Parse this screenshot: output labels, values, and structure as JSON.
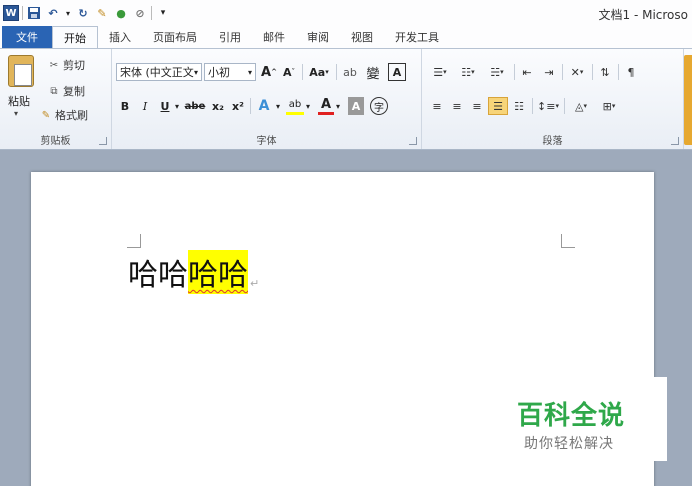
{
  "window": {
    "title": "文档1 - Microso"
  },
  "qat": {
    "word_icon": "W",
    "save_icon": "save-icon",
    "undo_icon": "undo-icon",
    "redo_icon": "redo-icon",
    "more": "▾"
  },
  "tabs": [
    {
      "label": "文件"
    },
    {
      "label": "开始"
    },
    {
      "label": "插入"
    },
    {
      "label": "页面布局"
    },
    {
      "label": "引用"
    },
    {
      "label": "邮件"
    },
    {
      "label": "审阅"
    },
    {
      "label": "视图"
    },
    {
      "label": "开发工具"
    }
  ],
  "clipboard": {
    "paste": "粘贴",
    "cut": "剪切",
    "copy": "复制",
    "format_painter": "格式刷",
    "group_label": "剪贴板"
  },
  "font": {
    "font_name": "宋体 (中文正文",
    "font_size": "小初",
    "group_label": "字体",
    "grow": "A",
    "shrink": "A",
    "case": "Aa",
    "clear": "ab",
    "phonetic": "變",
    "border": "A",
    "bold": "B",
    "italic": "I",
    "underline": "U",
    "strike": "abe",
    "sub": "x₂",
    "sup": "x²",
    "effects": "A",
    "highlight": "ab",
    "color": "A",
    "shading": "A",
    "enclose": "字"
  },
  "paragraph": {
    "group_label": "段落"
  },
  "document": {
    "text_normal": "哈哈",
    "text_highlight": "哈哈",
    "para_mark": "↵"
  },
  "watermark": {
    "main": "百科全说",
    "sub": "助你轻松解决"
  },
  "colors": {
    "file_tab": "#2a64b4",
    "highlight": "#ffff00",
    "watermark_green": "#2fa84a"
  }
}
